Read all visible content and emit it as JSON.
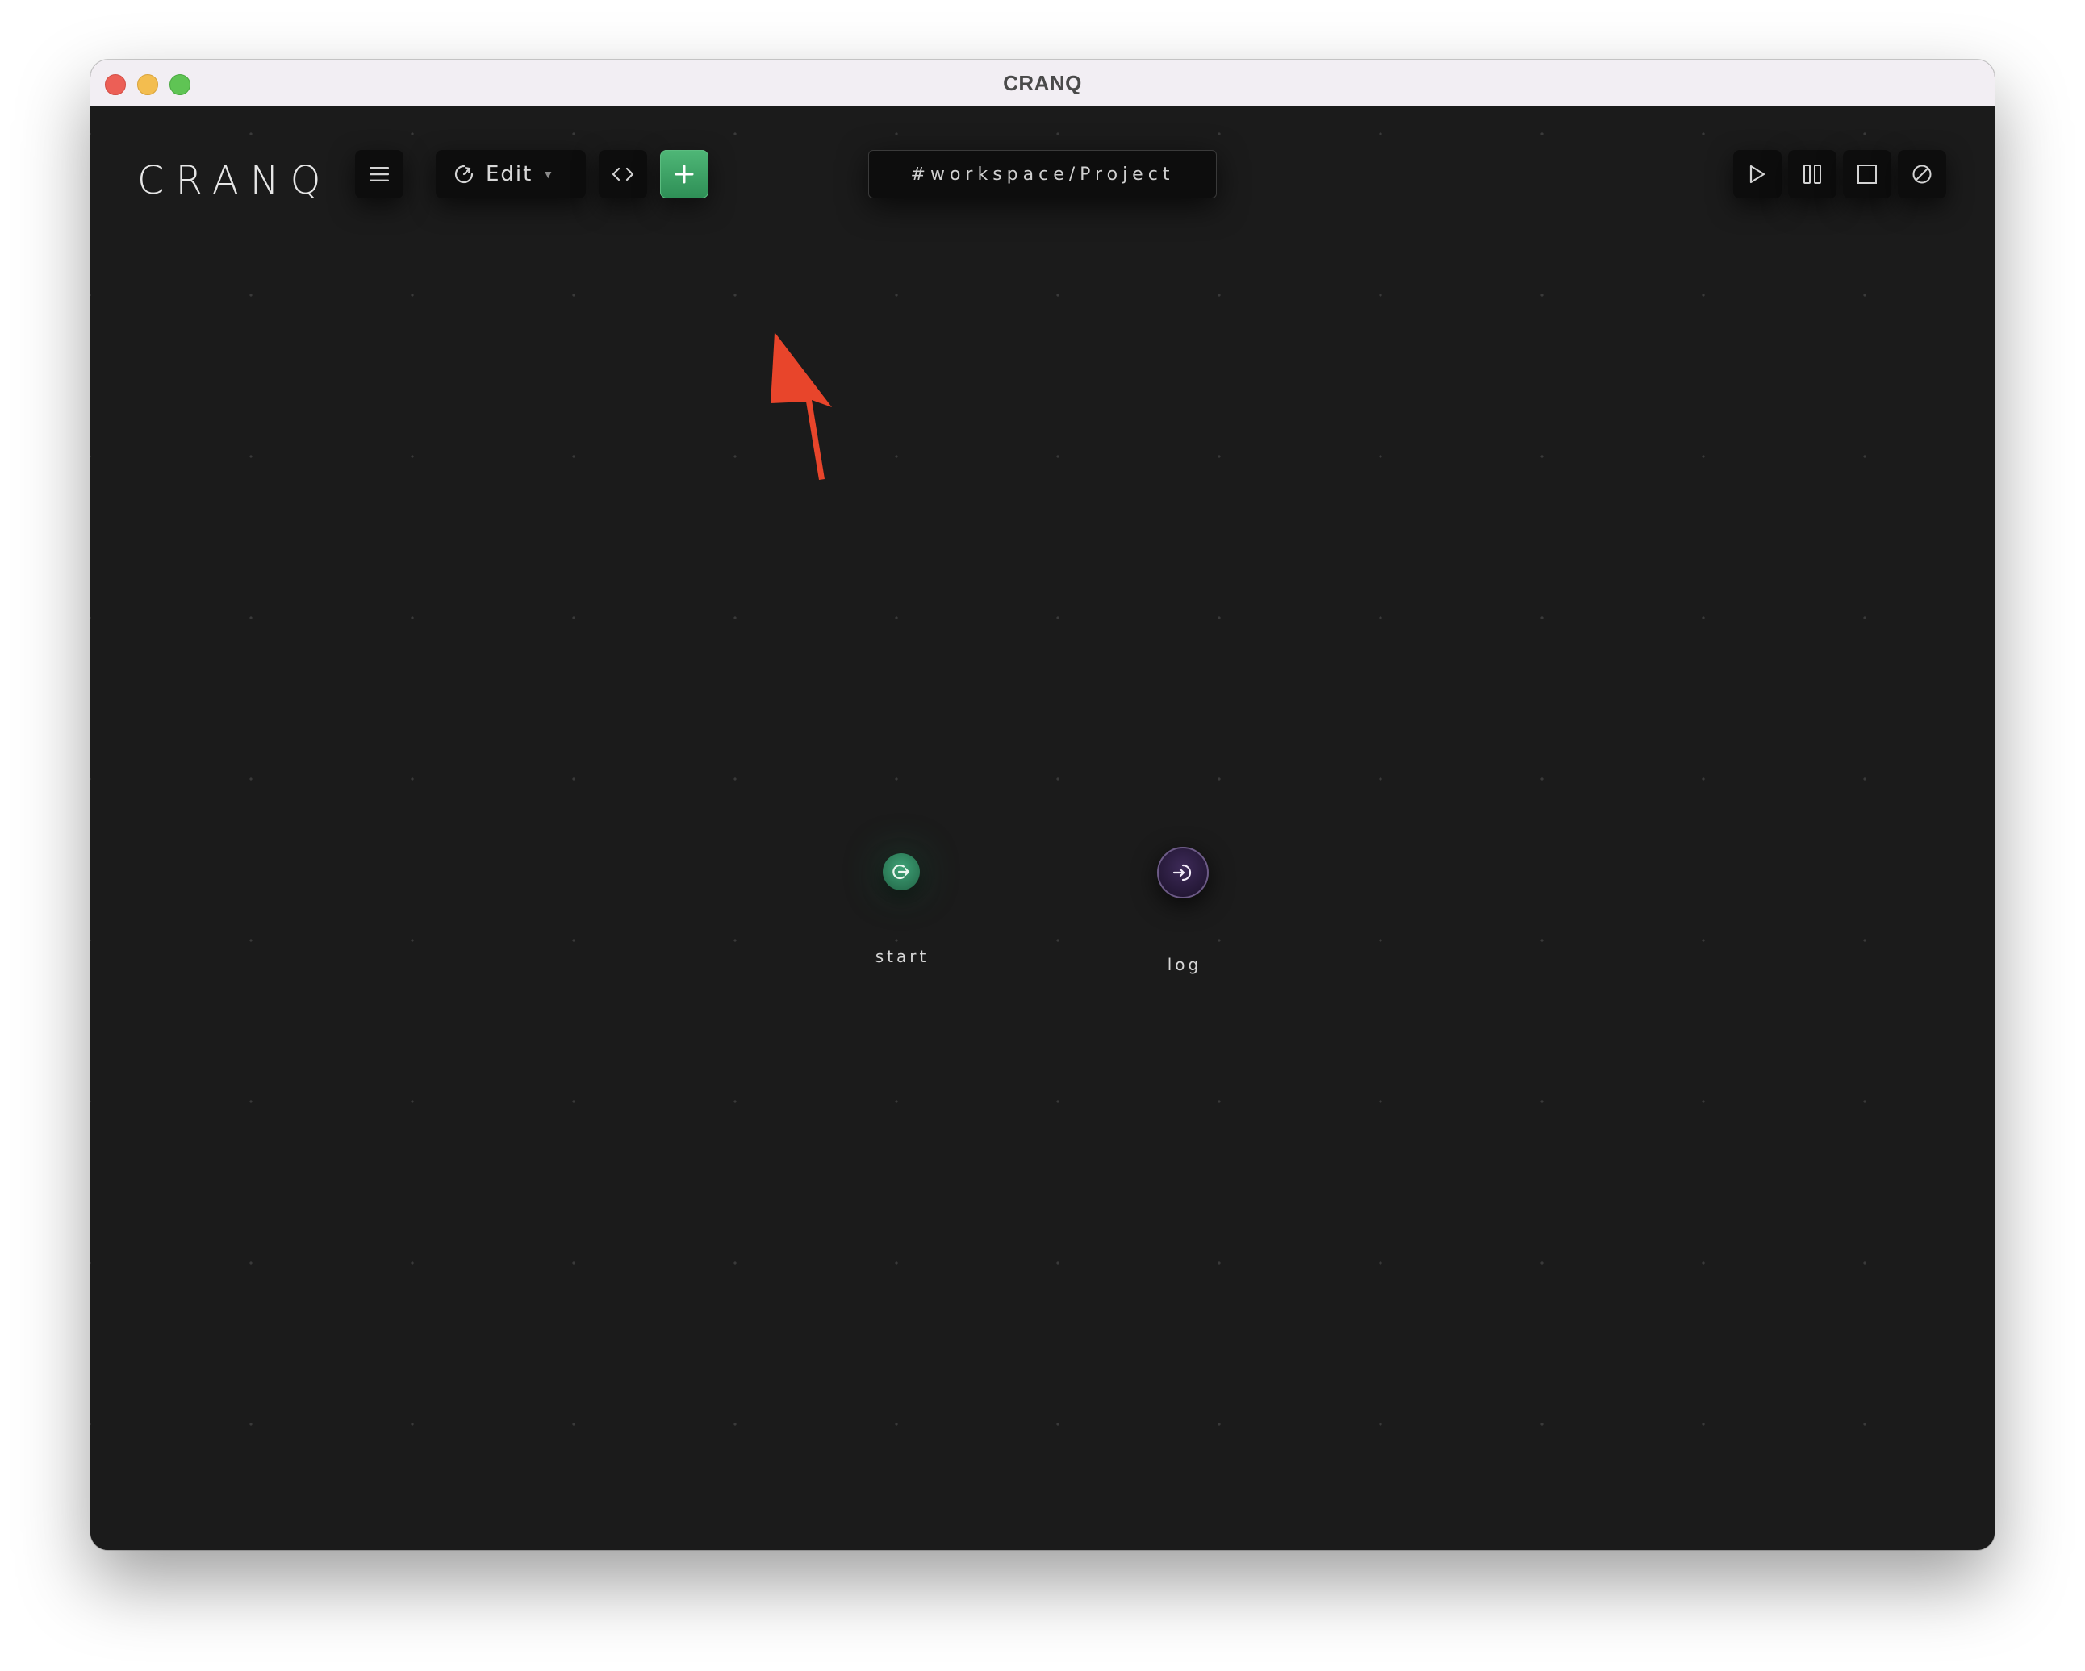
{
  "window": {
    "title": "CRANQ"
  },
  "toolbar": {
    "logo": "CRANQ",
    "mode_label": "Edit",
    "workspace_path": "#workspace/Project"
  },
  "nodes": [
    {
      "label": "start",
      "icon": "exit-icon",
      "color": "#2f8a60"
    },
    {
      "label": "log",
      "icon": "enter-icon",
      "color": "#2a1b3d"
    }
  ],
  "colors": {
    "add_button": "#3fa86a",
    "annotation_arrow": "#e8452b",
    "canvas_background": "#1b1b1b"
  }
}
